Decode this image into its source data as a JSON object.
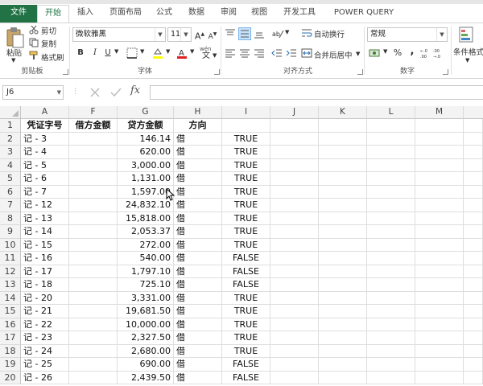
{
  "ribbon_tabs": [
    {
      "label": "文件"
    },
    {
      "label": "开始"
    },
    {
      "label": "插入"
    },
    {
      "label": "页面布局"
    },
    {
      "label": "公式"
    },
    {
      "label": "数据"
    },
    {
      "label": "审阅"
    },
    {
      "label": "视图"
    },
    {
      "label": "开发工具"
    },
    {
      "label": "POWER QUERY"
    }
  ],
  "clipboard": {
    "paste": "粘贴",
    "cut": "剪切",
    "copy": "复制",
    "format_painter": "格式刷",
    "group": "剪贴板"
  },
  "font": {
    "name": "微软雅黑",
    "size": "11",
    "bold": "B",
    "italic": "I",
    "underline": "U",
    "group": "字体",
    "wen": "wén"
  },
  "alignment": {
    "wrap_text": "自动换行",
    "merge_center": "合并后居中",
    "group": "对齐方式"
  },
  "number": {
    "format": "常规",
    "percent": "%",
    "comma": ",",
    "group": "数字"
  },
  "styles": {
    "conditional_format": "条件格式"
  },
  "formula_bar": {
    "name_box": "J6",
    "fx": "fx",
    "formula": ""
  },
  "columns": [
    "A",
    "F",
    "G",
    "H",
    "I",
    "J",
    "K",
    "L",
    "M"
  ],
  "headers": {
    "A": "凭证字号",
    "F": "借方金额",
    "G": "贷方金额",
    "H": "方向",
    "I": ""
  },
  "rows": [
    {
      "n": "2",
      "A": "记 - 3",
      "F": "",
      "G": "146.14",
      "H": "借",
      "I": "TRUE"
    },
    {
      "n": "3",
      "A": "记 - 4",
      "F": "",
      "G": "620.00",
      "H": "借",
      "I": "TRUE"
    },
    {
      "n": "4",
      "A": "记 - 5",
      "F": "",
      "G": "3,000.00",
      "H": "借",
      "I": "TRUE"
    },
    {
      "n": "5",
      "A": "记 - 6",
      "F": "",
      "G": "1,131.00",
      "H": "借",
      "I": "TRUE"
    },
    {
      "n": "6",
      "A": "记 - 7",
      "F": "",
      "G": "1,597.00",
      "H": "借",
      "I": "TRUE"
    },
    {
      "n": "7",
      "A": "记 - 12",
      "F": "",
      "G": "24,832.10",
      "H": "借",
      "I": "TRUE"
    },
    {
      "n": "8",
      "A": "记 - 13",
      "F": "",
      "G": "15,818.00",
      "H": "借",
      "I": "TRUE"
    },
    {
      "n": "9",
      "A": "记 - 14",
      "F": "",
      "G": "2,053.37",
      "H": "借",
      "I": "TRUE"
    },
    {
      "n": "10",
      "A": "记 - 15",
      "F": "",
      "G": "272.00",
      "H": "借",
      "I": "TRUE"
    },
    {
      "n": "11",
      "A": "记 - 16",
      "F": "",
      "G": "540.00",
      "H": "借",
      "I": "FALSE"
    },
    {
      "n": "12",
      "A": "记 - 17",
      "F": "",
      "G": "1,797.10",
      "H": "借",
      "I": "FALSE"
    },
    {
      "n": "13",
      "A": "记 - 18",
      "F": "",
      "G": "725.10",
      "H": "借",
      "I": "FALSE"
    },
    {
      "n": "14",
      "A": "记 - 20",
      "F": "",
      "G": "3,331.00",
      "H": "借",
      "I": "TRUE"
    },
    {
      "n": "15",
      "A": "记 - 21",
      "F": "",
      "G": "19,681.50",
      "H": "借",
      "I": "TRUE"
    },
    {
      "n": "16",
      "A": "记 - 22",
      "F": "",
      "G": "10,000.00",
      "H": "借",
      "I": "TRUE"
    },
    {
      "n": "17",
      "A": "记 - 23",
      "F": "",
      "G": "2,327.50",
      "H": "借",
      "I": "TRUE"
    },
    {
      "n": "18",
      "A": "记 - 24",
      "F": "",
      "G": "2,680.00",
      "H": "借",
      "I": "TRUE"
    },
    {
      "n": "19",
      "A": "记 - 25",
      "F": "",
      "G": "690.00",
      "H": "借",
      "I": "FALSE"
    },
    {
      "n": "20",
      "A": "记 - 26",
      "F": "",
      "G": "2,439.50",
      "H": "借",
      "I": "FALSE"
    }
  ],
  "colors": {
    "accent": "#217346",
    "header_bg": "#f3f3f3",
    "gridline": "#dedede"
  }
}
